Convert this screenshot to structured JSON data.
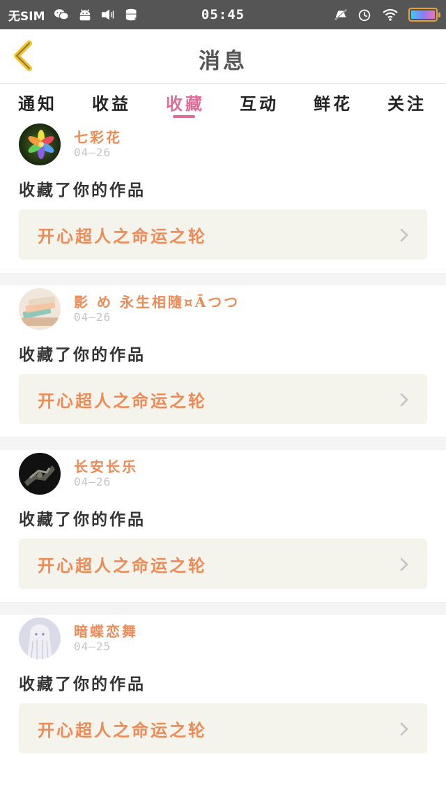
{
  "status_bar": {
    "carrier": "无SIM",
    "time": "05:45",
    "left_icons": [
      "wechat-icon",
      "android-icon",
      "vibrate-icon",
      "storage-icon"
    ],
    "right_icons": [
      "mute-icon",
      "alarm-icon",
      "wifi-icon",
      "battery-icon"
    ]
  },
  "nav": {
    "title": "消息",
    "back_icon": "chevron-left-icon"
  },
  "tabs": [
    {
      "label": "通知",
      "active": false
    },
    {
      "label": "收益",
      "active": false
    },
    {
      "label": "收藏",
      "active": true
    },
    {
      "label": "互动",
      "active": false
    },
    {
      "label": "鲜花",
      "active": false
    },
    {
      "label": "关注",
      "active": false
    }
  ],
  "feed": [
    {
      "name": "七彩花",
      "date": "04—26",
      "action": "收藏了你的作品",
      "work": "开心超人之命运之轮",
      "avatar": "flower"
    },
    {
      "name": "影 め 永生相隨¤Āつつ",
      "date": "04—26",
      "action": "收藏了你的作品",
      "work": "开心超人之命运之轮",
      "avatar": "books"
    },
    {
      "name": "长安长乐",
      "date": "04—26",
      "action": "收藏了你的作品",
      "work": "开心超人之命运之轮",
      "avatar": "dark"
    },
    {
      "name": "暗蝶恋舞",
      "date": "04—25",
      "action": "收藏了你的作品",
      "work": "开心超人之命运之轮",
      "avatar": "anime"
    }
  ],
  "colors": {
    "accent_pink": "#e06c95",
    "name_orange": "#ef8a55",
    "back_yellow": "#f2c230"
  }
}
